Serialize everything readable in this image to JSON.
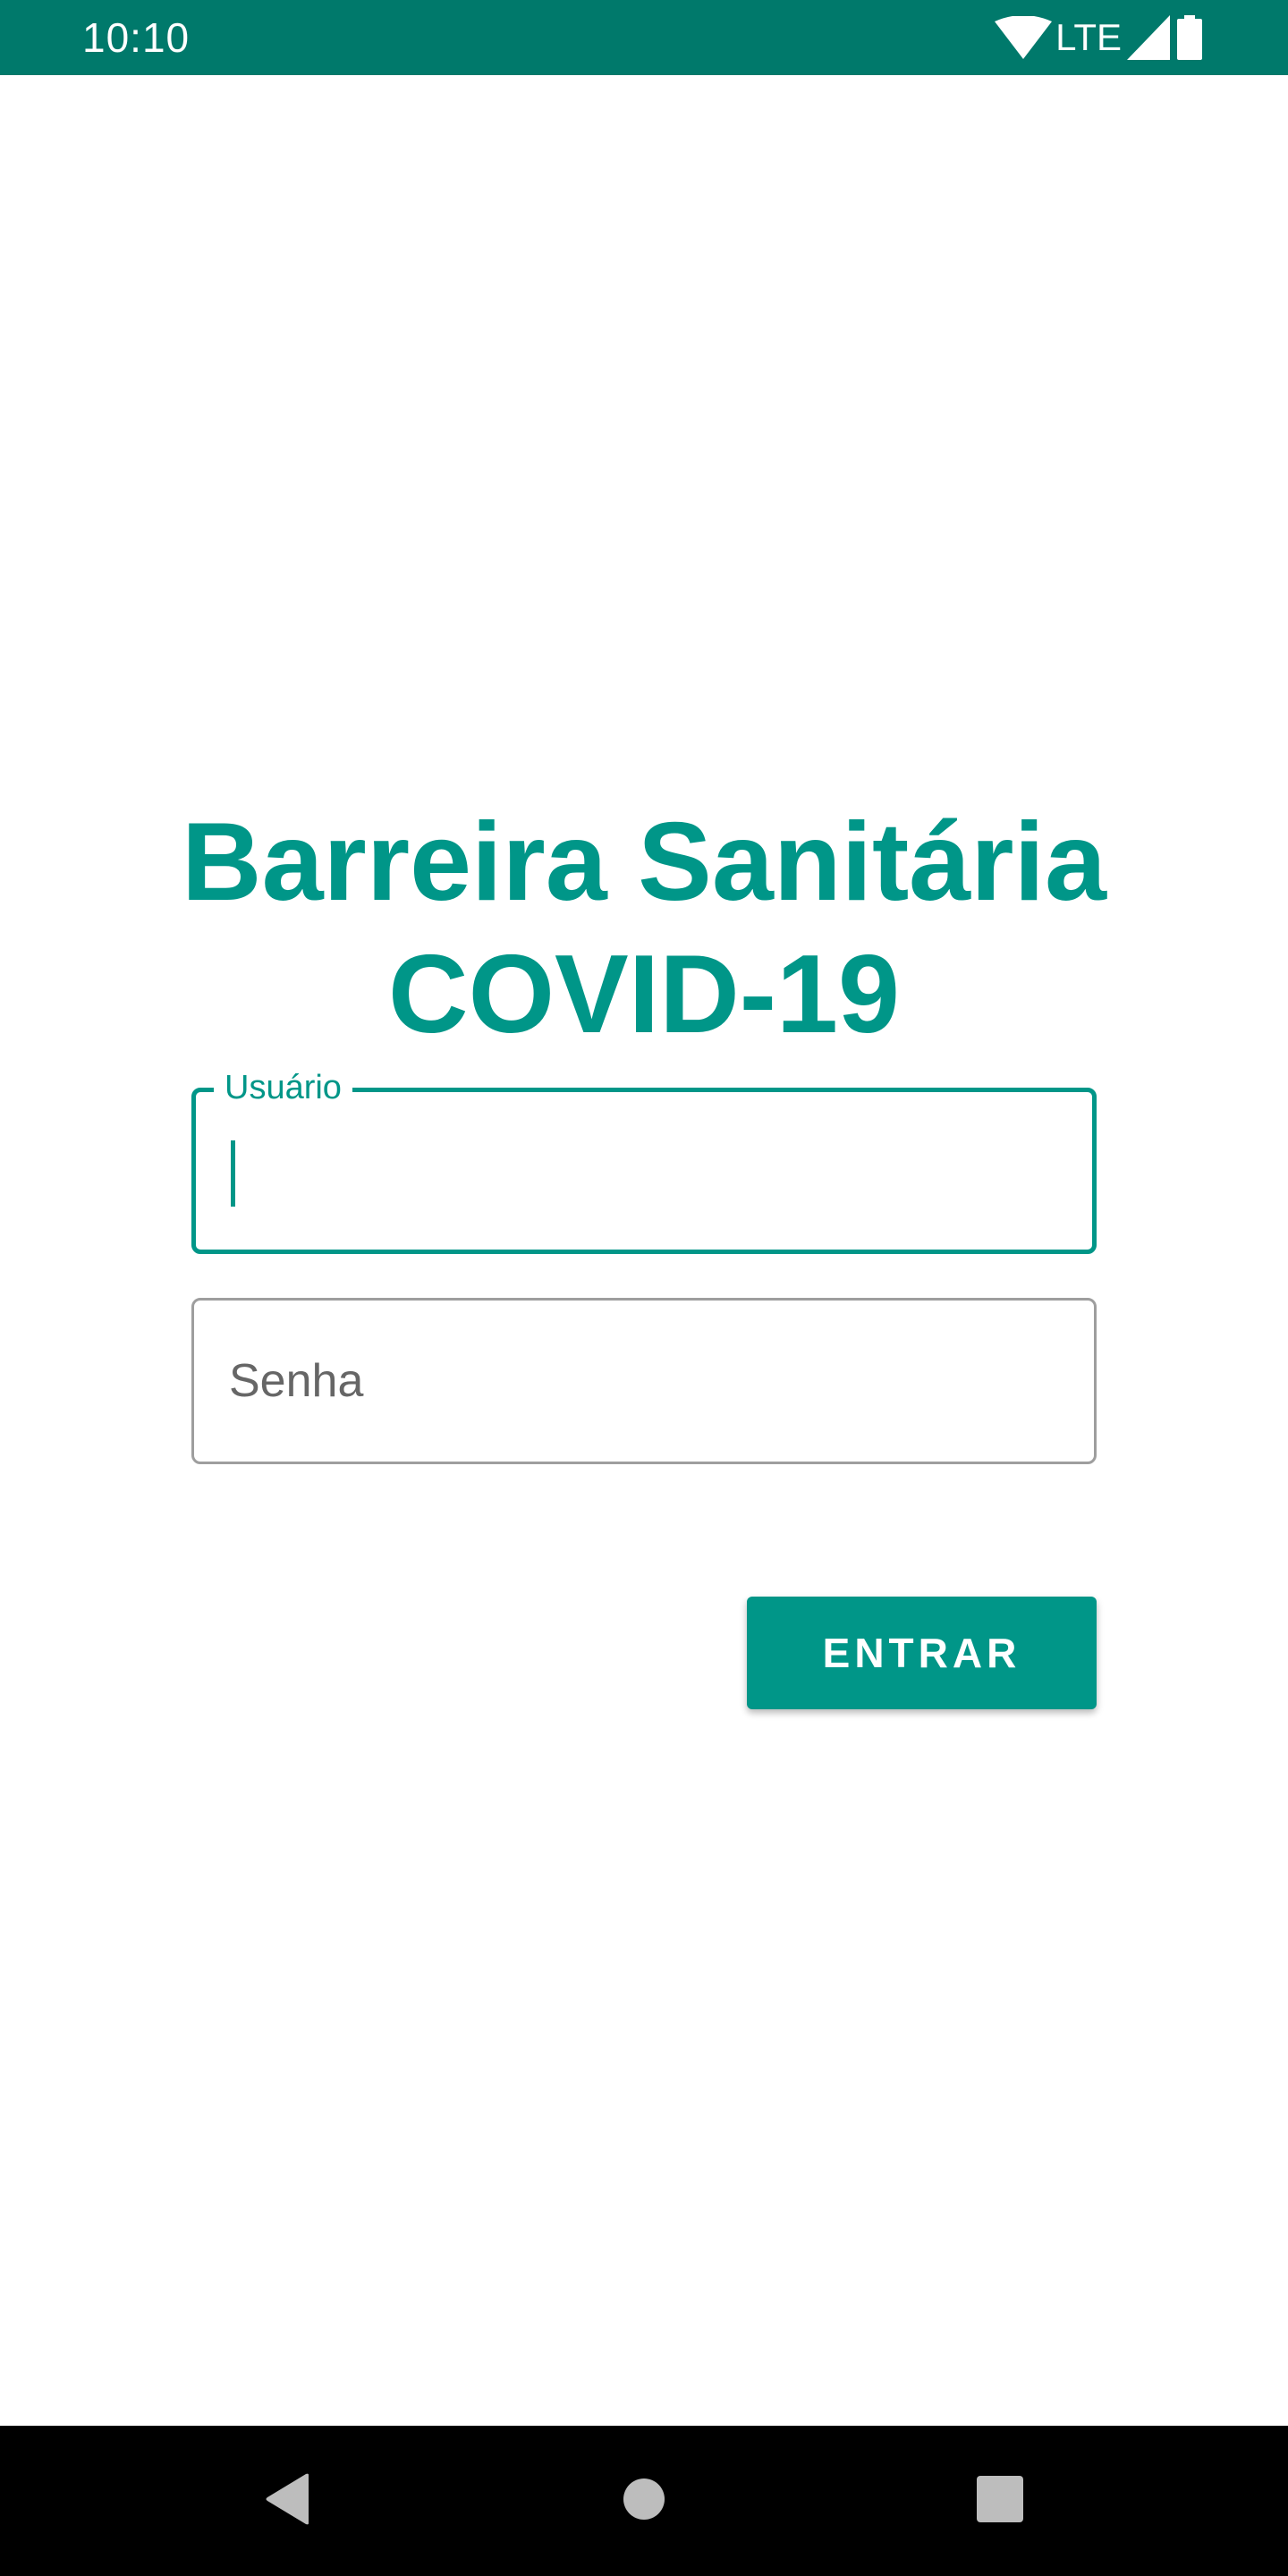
{
  "status_bar": {
    "time": "10:10",
    "network": "LTE",
    "icons": [
      "wifi-icon",
      "signal-icon",
      "battery-icon"
    ],
    "background_color": "#00796b"
  },
  "app": {
    "title_line1": "Barreira Sanitária",
    "title_line2": "COVID-19",
    "accent_color": "#009688"
  },
  "form": {
    "username": {
      "label": "Usuário",
      "value": ""
    },
    "password": {
      "placeholder": "Senha",
      "value": ""
    },
    "submit_label": "ENTRAR"
  },
  "nav_bar": {
    "icons": [
      "back-icon",
      "home-icon",
      "recents-icon"
    ]
  }
}
